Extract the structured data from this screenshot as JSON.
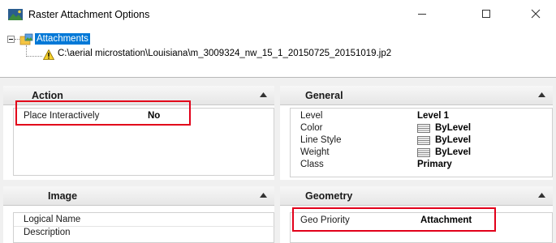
{
  "window": {
    "title": "Raster Attachment Options",
    "minimize_glyph": "—",
    "maximize_glyph": "☐",
    "close_glyph": "✕"
  },
  "tree": {
    "root_label": "Attachments",
    "file_path": "C:\\aerial microstation\\Louisiana\\m_3009324_nw_15_1_20150725_20151019.jp2"
  },
  "panels": {
    "action": {
      "title": "Action",
      "rows": [
        {
          "label": "Place Interactively",
          "value": "No"
        }
      ]
    },
    "general": {
      "title": "General",
      "rows": [
        {
          "label": "Level",
          "value": "Level 1"
        },
        {
          "label": "Color",
          "value": "ByLevel",
          "icon": "color-swatch-icon"
        },
        {
          "label": "Line Style",
          "value": "ByLevel",
          "icon": "line-style-swatch-icon"
        },
        {
          "label": "Weight",
          "value": "ByLevel",
          "icon": "weight-swatch-icon"
        },
        {
          "label": "Class",
          "value": "Primary"
        }
      ]
    },
    "image": {
      "title": "Image",
      "rows": [
        {
          "label": "Logical Name",
          "value": ""
        },
        {
          "label": "Description",
          "value": ""
        }
      ]
    },
    "geometry": {
      "title": "Geometry",
      "rows": [
        {
          "label": "Geo Priority",
          "value": "Attachment"
        }
      ]
    }
  },
  "colors": {
    "selection": "#0078d7",
    "highlight_box": "#e2001a",
    "panel_background": "#f0f0f0"
  }
}
